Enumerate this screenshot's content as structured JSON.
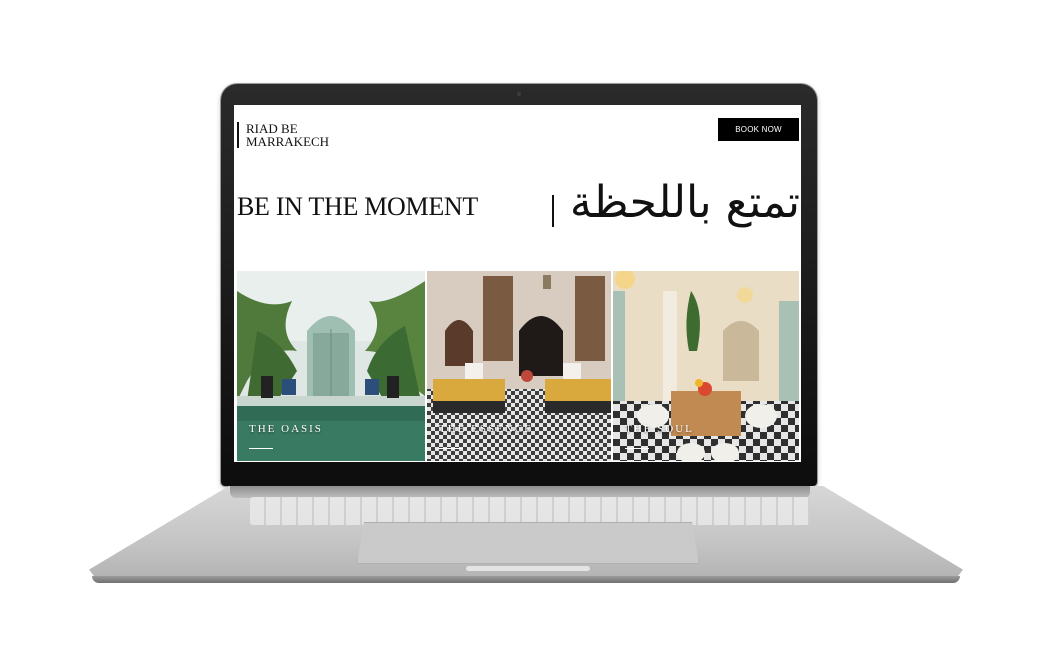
{
  "site": {
    "logo_line1": "RIAD BE",
    "logo_line2": "MARRAKECH",
    "book_button": "BOOK NOW",
    "headline": "BE IN THE MOMENT",
    "headline_arabic": "تمتع باللحظة"
  },
  "tiles": [
    {
      "label": "THE OASIS",
      "image": "courtyard-palms-pool"
    },
    {
      "label": "THE ESSENCE",
      "image": "lounge-sofas-arches"
    },
    {
      "label": "THE SOUL",
      "image": "dining-table-checkered-floor"
    }
  ],
  "colors": {
    "button_bg": "#000000",
    "text": "#111111",
    "accent_green": "#2f6b55"
  }
}
